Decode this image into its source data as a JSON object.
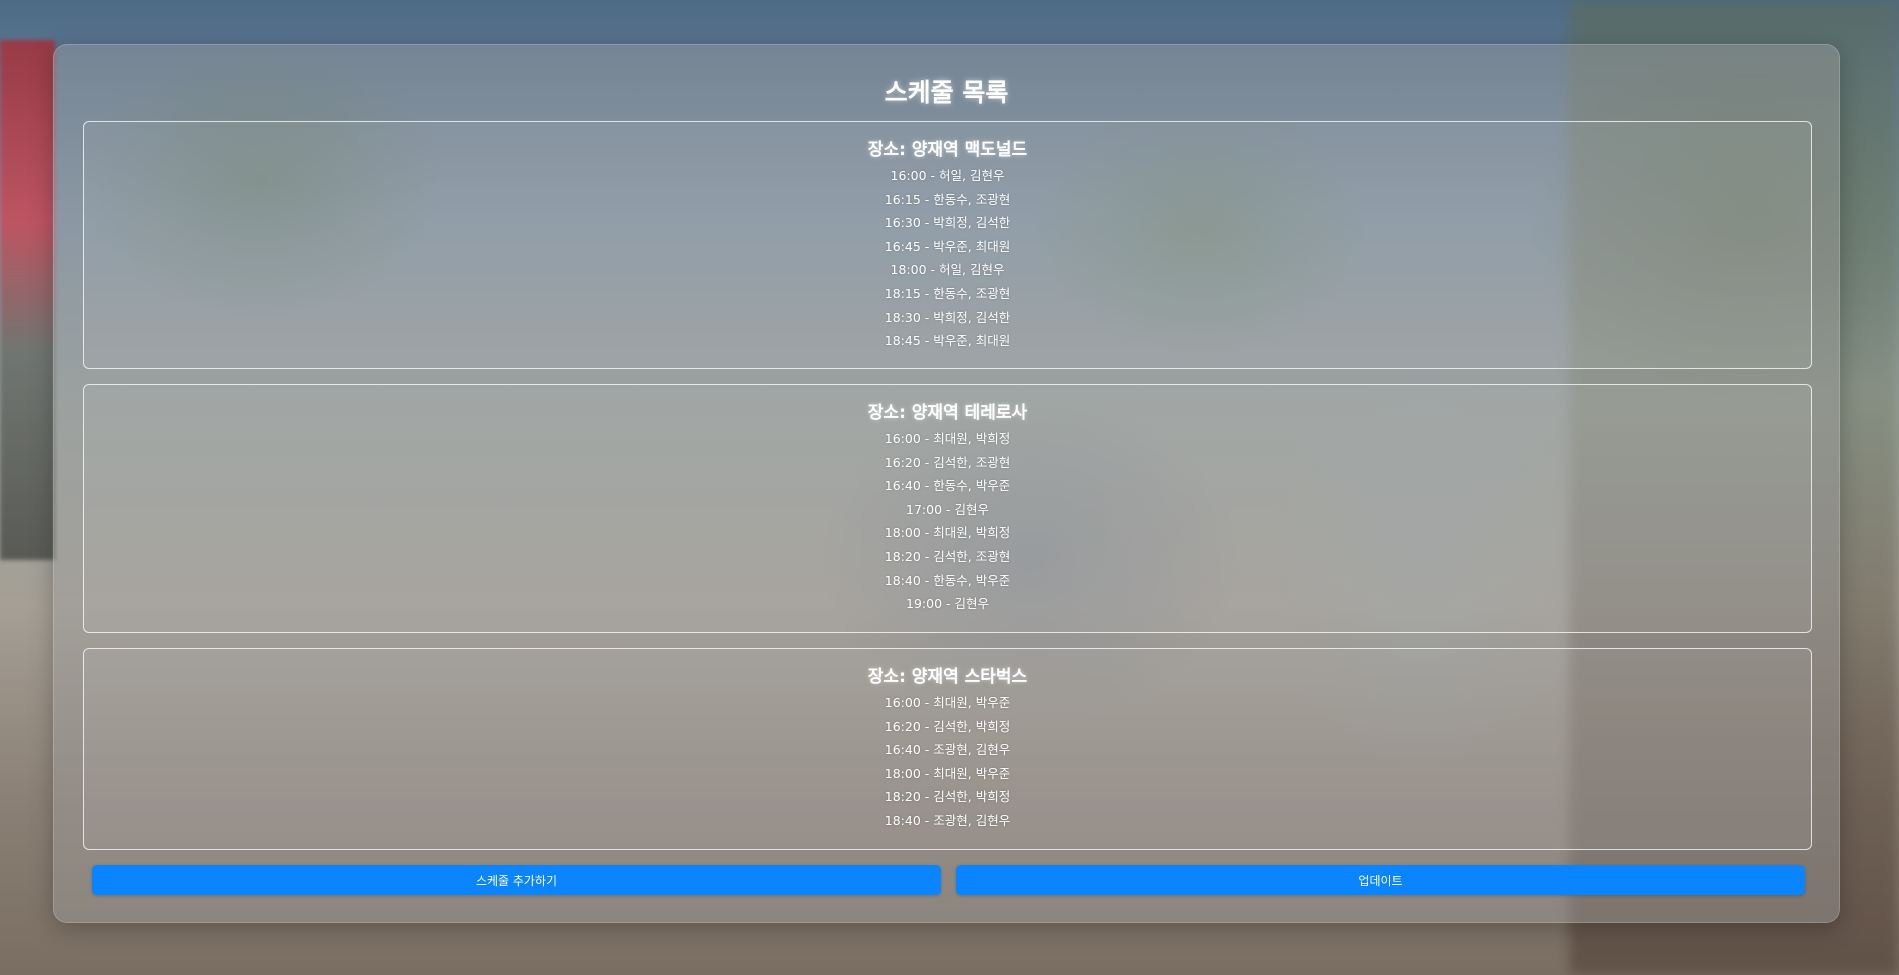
{
  "page": {
    "title": "스케줄 목록"
  },
  "locations": [
    {
      "title": "장소: 양재역 맥도널드",
      "items": [
        "16:00 - 허일, 김현우",
        "16:15 - 한동수, 조광현",
        "16:30 - 박희정, 김석한",
        "16:45 - 박우준, 최대원",
        "18:00 - 허일, 김현우",
        "18:15 - 한동수, 조광현",
        "18:30 - 박희정, 김석한",
        "18:45 - 박우준, 최대원"
      ]
    },
    {
      "title": "장소: 양재역 테레로사",
      "items": [
        "16:00 - 최대원, 박희정",
        "16:20 - 김석한, 조광현",
        "16:40 - 한동수, 박우준",
        "17:00 - 김현우",
        "18:00 - 최대원, 박희정",
        "18:20 - 김석한, 조광현",
        "18:40 - 한동수, 박우준",
        "19:00 - 김현우"
      ]
    },
    {
      "title": "장소: 양재역 스타벅스",
      "items": [
        "16:00 - 최대원, 박우준",
        "16:20 - 김석한, 박희정",
        "16:40 - 조광현, 김현우",
        "18:00 - 최대원, 박우준",
        "18:20 - 김석한, 박희정",
        "18:40 - 조광현, 김현우"
      ]
    }
  ],
  "buttons": {
    "add_label": "스케줄 추가하기",
    "update_label": "업데이트"
  },
  "colors": {
    "accent": "#0a84ff"
  }
}
